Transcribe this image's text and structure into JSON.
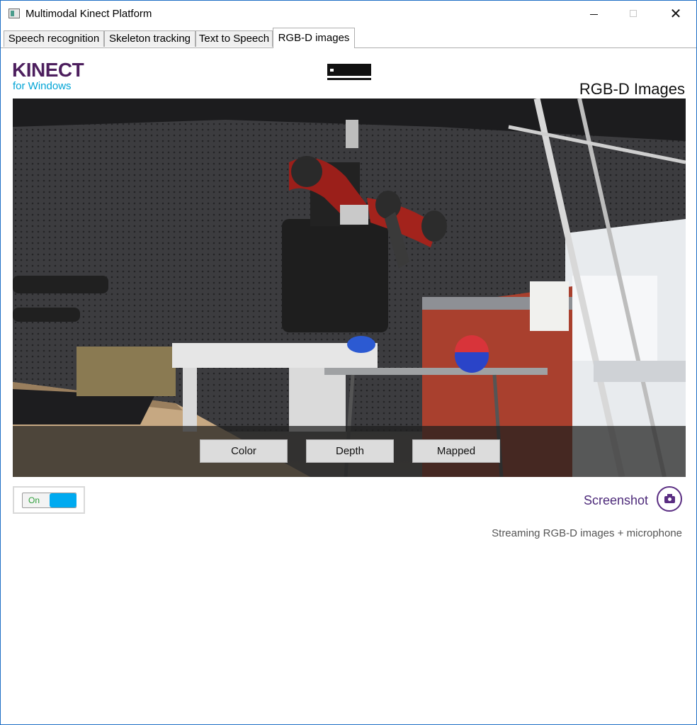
{
  "window": {
    "title": "Multimodal Kinect Platform",
    "controls": [
      "minimize",
      "maximize",
      "close"
    ]
  },
  "tabs": [
    {
      "label": "Speech recognition",
      "active": false
    },
    {
      "label": "Skeleton tracking",
      "active": false
    },
    {
      "label": "Text to Speech",
      "active": false
    },
    {
      "label": "RGB-D images",
      "active": true
    }
  ],
  "header": {
    "logo_main": "KINECT",
    "logo_sub": "for Windows",
    "sensor_icon": "kinect-sensor-icon",
    "page_title": "RGB-D Images"
  },
  "viewer": {
    "modes": [
      "Color",
      "Depth",
      "Mapped"
    ]
  },
  "stream_toggle": {
    "label": "On",
    "state": "on"
  },
  "screenshot": {
    "label": "Screenshot",
    "icon": "camera-icon"
  },
  "status_text": "Streaming RGB-D images + microphone",
  "colors": {
    "brand_purple": "#4d1f5e",
    "brand_cyan": "#00a4d6",
    "toggle_on": "#00aaf0",
    "screenshot_purple": "#5a2d82"
  }
}
